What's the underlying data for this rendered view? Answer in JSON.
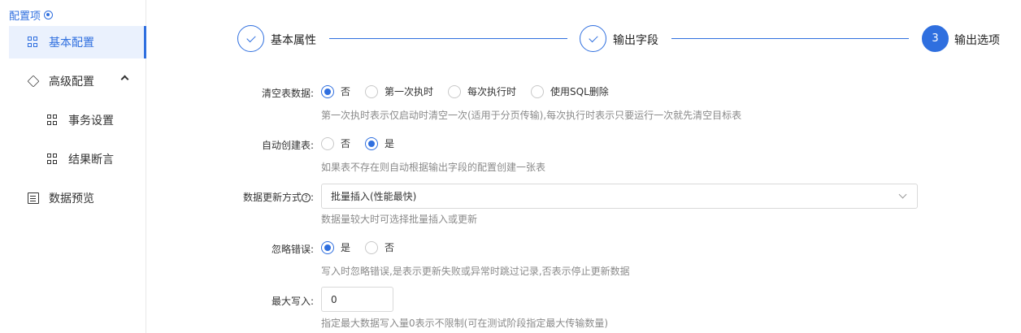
{
  "sidebar": {
    "title": "配置项",
    "items": [
      {
        "label": "基本配置"
      },
      {
        "label": "高级配置"
      },
      {
        "label": "事务设置"
      },
      {
        "label": "结果断言"
      },
      {
        "label": "数据预览"
      }
    ]
  },
  "steps": [
    {
      "label": "基本属性",
      "number": ""
    },
    {
      "label": "输出字段",
      "number": ""
    },
    {
      "label": "输出选项",
      "number": "3"
    }
  ],
  "form": {
    "clear_table": {
      "label": "清空表数据:",
      "options": [
        "否",
        "第一次执时",
        "每次执行时",
        "使用SQL删除"
      ],
      "selected": "否",
      "hint": "第一次执时表示仅启动时清空一次(适用于分页传输),每次执行时表示只要运行一次就先清空目标表"
    },
    "auto_create": {
      "label": "自动创建表:",
      "options": [
        "否",
        "是"
      ],
      "selected": "是",
      "hint": "如果表不存在则自动根据输出字段的配置创建一张表"
    },
    "update_mode": {
      "label": "数据更新方式",
      "label_suffix": ":",
      "value": "批量插入(性能最快)",
      "hint": "数据量较大时可选择批量插入或更新"
    },
    "ignore_error": {
      "label": "忽略错误:",
      "options": [
        "是",
        "否"
      ],
      "selected": "是",
      "hint": "写入时忽略错误,是表示更新失败或异常时跳过记录,否表示停止更新数据"
    },
    "max_write": {
      "label": "最大写入:",
      "value": "0",
      "hint": "指定最大数据写入量0表示不限制(可在测试阶段指定最大传输数量)"
    }
  },
  "colors": {
    "accent": "#2f6fdf",
    "border": "#d9d9d9",
    "hint": "#8a8a8a"
  }
}
